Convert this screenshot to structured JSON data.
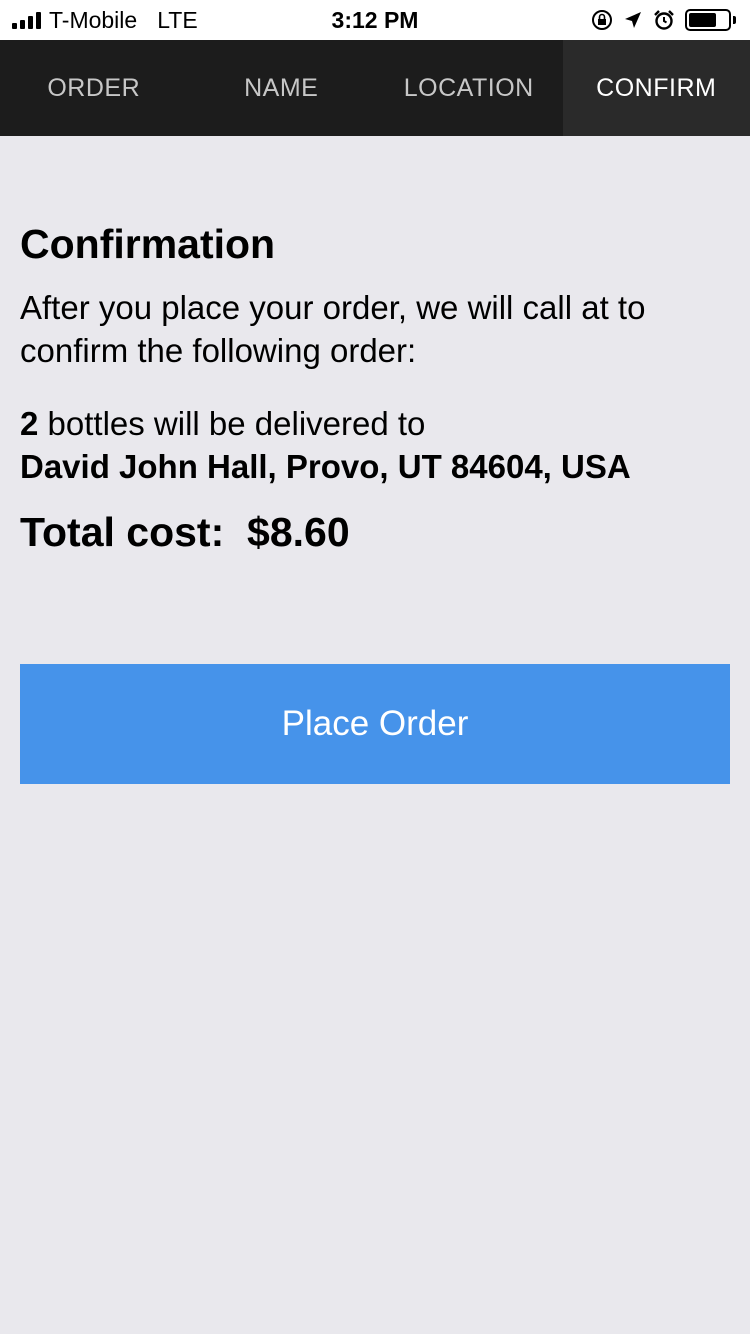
{
  "status_bar": {
    "carrier": "T-Mobile",
    "network": "LTE",
    "time": "3:12 PM",
    "icons": [
      "signal-icon",
      "orientation-lock-icon",
      "location-arrow-icon",
      "alarm-icon",
      "battery-icon"
    ],
    "battery_level": 0.7
  },
  "tabs": [
    {
      "label": "ORDER",
      "active": false
    },
    {
      "label": "NAME",
      "active": false
    },
    {
      "label": "LOCATION",
      "active": false
    },
    {
      "label": "CONFIRM",
      "active": true
    }
  ],
  "confirmation": {
    "title": "Confirmation",
    "intro": "After you place your order, we will call  at  to confirm the following order:",
    "quantity": "2",
    "delivery_text": " bottles will be delivered to",
    "address": "David John Hall, Provo, UT 84604, USA",
    "total_label": "Total cost:  ",
    "total_value": "$8.60"
  },
  "place_order_button": {
    "label": "Place Order"
  },
  "colors": {
    "tab_bar": "#1c1c1c",
    "active_tab": "#2a2a2a",
    "background": "#e9e8ed",
    "button": "#4693ea"
  }
}
